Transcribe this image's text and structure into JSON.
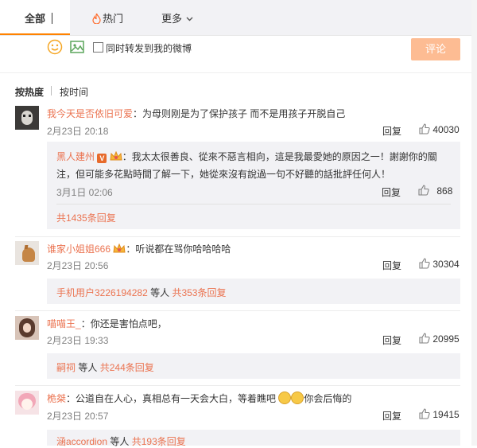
{
  "tabs": [
    {
      "label": "全部",
      "active": true
    },
    {
      "label": "热门",
      "icon": "fire-icon"
    },
    {
      "label": "更多",
      "icon": "chevron-down-icon"
    }
  ],
  "composer": {
    "repost_label": "同时转发到我的微博",
    "submit_label": "评论"
  },
  "sort": {
    "by_heat": "按热度",
    "by_time": "按时间"
  },
  "comments": [
    {
      "user": "我今天是否依旧可爱",
      "text": "：为母则刚是为了保护孩子 而不是用孩子开脱自己",
      "time": "2月23日 20:18",
      "reply": "回复",
      "likes": "40030",
      "sub": {
        "user": "黑人建州",
        "badge": "V",
        "text": "：我太太很善良、從來不惡言相向，這是我最愛她的原因之一！謝謝你的關注，但可能多花點時間了解一下，她從來沒有說過一句不好聽的話批評任何人！",
        "time": "3月1日 02:06",
        "reply": "回复",
        "likes": "868"
      },
      "more": "共1435条回复"
    },
    {
      "user": "谁家小姐姐666",
      "text": "：听说都在骂你哈哈哈哈",
      "time": "2月23日 20:56",
      "reply": "回复",
      "likes": "30304",
      "replier": "手机用户3226194282",
      "and_others": "等人",
      "more": "共353条回复"
    },
    {
      "user": "喵喵王_",
      "text": "：你还是害怕点吧，",
      "time": "2月23日 19:33",
      "reply": "回复",
      "likes": "20995",
      "replier": "嗣祠",
      "and_others": "等人",
      "more": "共244条回复"
    },
    {
      "user": "桅桀",
      "text": "：公道自在人心，真相总有一天会大白，等着瞧吧",
      "text_tail": "你会后悔的",
      "time": "2月23日 20:57",
      "reply": "回复",
      "likes": "19415",
      "replier": "涵accordion",
      "and_others": "等人",
      "more": "共193条回复"
    }
  ],
  "colors": {
    "accent": "#ff8200",
    "link": "#eb7350",
    "button": "#fdbc93",
    "panel": "#f2f2f5"
  }
}
